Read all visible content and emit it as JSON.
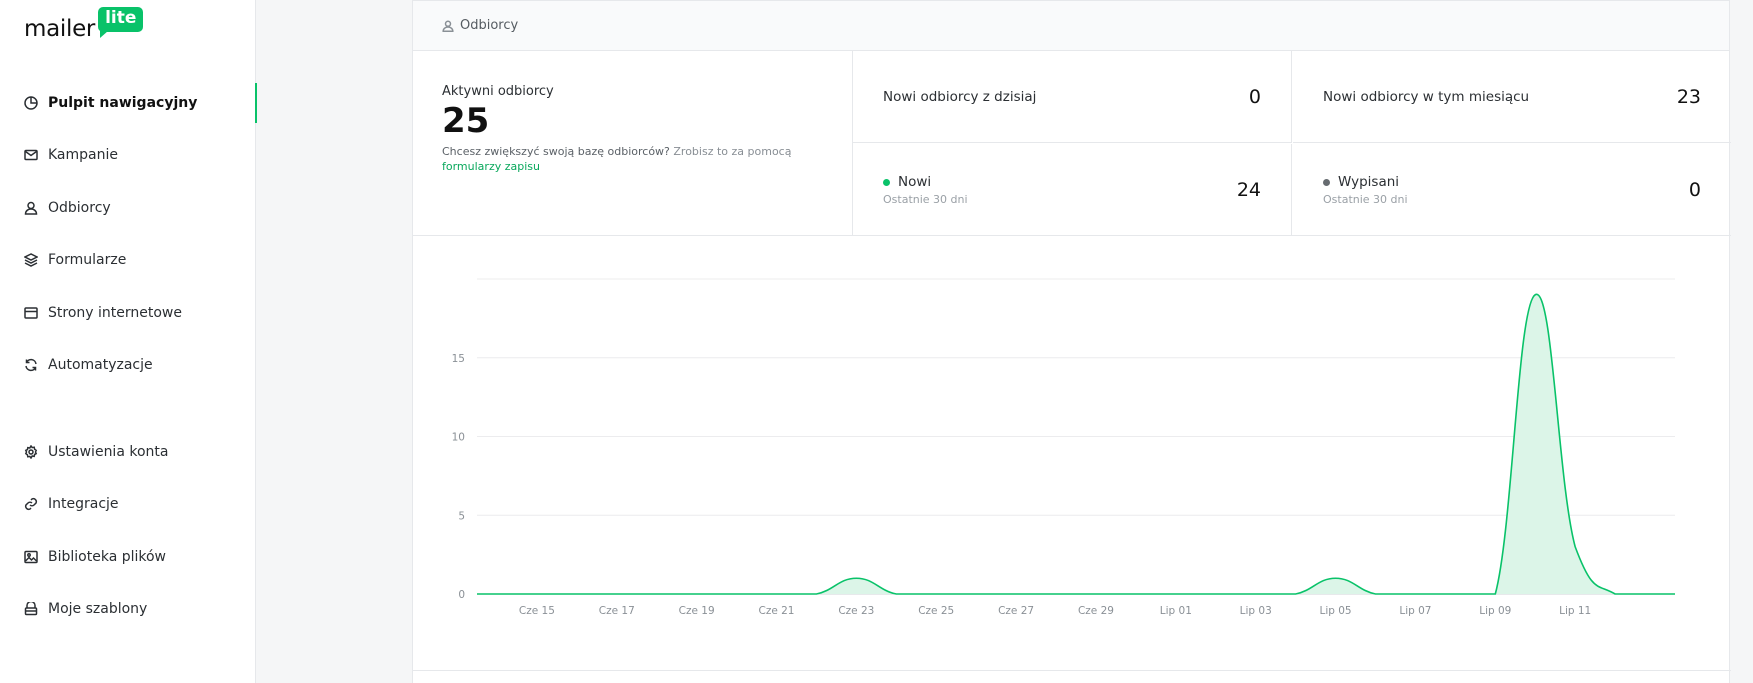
{
  "brand": {
    "name": "mailer",
    "badge": "lite",
    "accent": "#09c269"
  },
  "sidebar": {
    "items": [
      {
        "label": "Pulpit nawigacyjny",
        "icon": "dashboard-icon",
        "active": true
      },
      {
        "label": "Kampanie",
        "icon": "mail-icon"
      },
      {
        "label": "Odbiorcy",
        "icon": "user-icon"
      },
      {
        "label": "Formularze",
        "icon": "layers-icon"
      },
      {
        "label": "Strony internetowe",
        "icon": "browser-icon"
      },
      {
        "label": "Automatyzacje",
        "icon": "refresh-icon"
      },
      {
        "label": "Ustawienia konta",
        "icon": "gear-icon"
      },
      {
        "label": "Integracje",
        "icon": "link-icon"
      },
      {
        "label": "Biblioteka plików",
        "icon": "image-icon"
      },
      {
        "label": "Moje szablony",
        "icon": "template-icon"
      }
    ]
  },
  "panel": {
    "header": "Odbiorcy",
    "active": {
      "label": "Aktywni odbiorcy",
      "value": "25",
      "hint_lead": "Chcesz zwiększyć swoją bazę odbiorców?",
      "hint_tail": "Zrobisz to za pomocą",
      "hint_link": "formularzy zapisu"
    },
    "today": {
      "label": "Nowi odbiorcy z dzisiaj",
      "value": "0"
    },
    "month": {
      "label": "Nowi odbiorcy w tym miesiącu",
      "value": "23"
    },
    "new": {
      "label": "Nowi",
      "sub": "Ostatnie 30 dni",
      "value": "24",
      "color": "#09c269"
    },
    "unsub": {
      "label": "Wypisani",
      "sub": "Ostatnie 30 dni",
      "value": "0",
      "color": "#666b70"
    }
  },
  "chart_data": {
    "type": "area",
    "x": [
      "Cze 14",
      "Cze 15",
      "Cze 16",
      "Cze 17",
      "Cze 18",
      "Cze 19",
      "Cze 20",
      "Cze 21",
      "Cze 22",
      "Cze 23",
      "Cze 24",
      "Cze 25",
      "Cze 26",
      "Cze 27",
      "Cze 28",
      "Cze 29",
      "Cze 30",
      "Lip 01",
      "Lip 02",
      "Lip 03",
      "Lip 04",
      "Lip 05",
      "Lip 06",
      "Lip 07",
      "Lip 08",
      "Lip 09",
      "Lip 10",
      "Lip 11",
      "Lip 12",
      "Lip 13"
    ],
    "x_ticks": [
      "Cze 15",
      "Cze 17",
      "Cze 19",
      "Cze 21",
      "Cze 23",
      "Cze 25",
      "Cze 27",
      "Cze 29",
      "Lip 01",
      "Lip 03",
      "Lip 05",
      "Lip 07",
      "Lip 09",
      "Lip 11"
    ],
    "series": [
      {
        "values": [
          0,
          0,
          0,
          0,
          0,
          0,
          0,
          0,
          0,
          1,
          0,
          0,
          0,
          0,
          0,
          0,
          0,
          0,
          0,
          0,
          0,
          1,
          0,
          0,
          0,
          0,
          19,
          3,
          0,
          0
        ]
      }
    ],
    "y_ticks": [
      0,
      5,
      10,
      15
    ],
    "ylim": [
      0,
      20
    ],
    "grid": true,
    "color": "#09c269",
    "fill": "#dcf5e8"
  }
}
